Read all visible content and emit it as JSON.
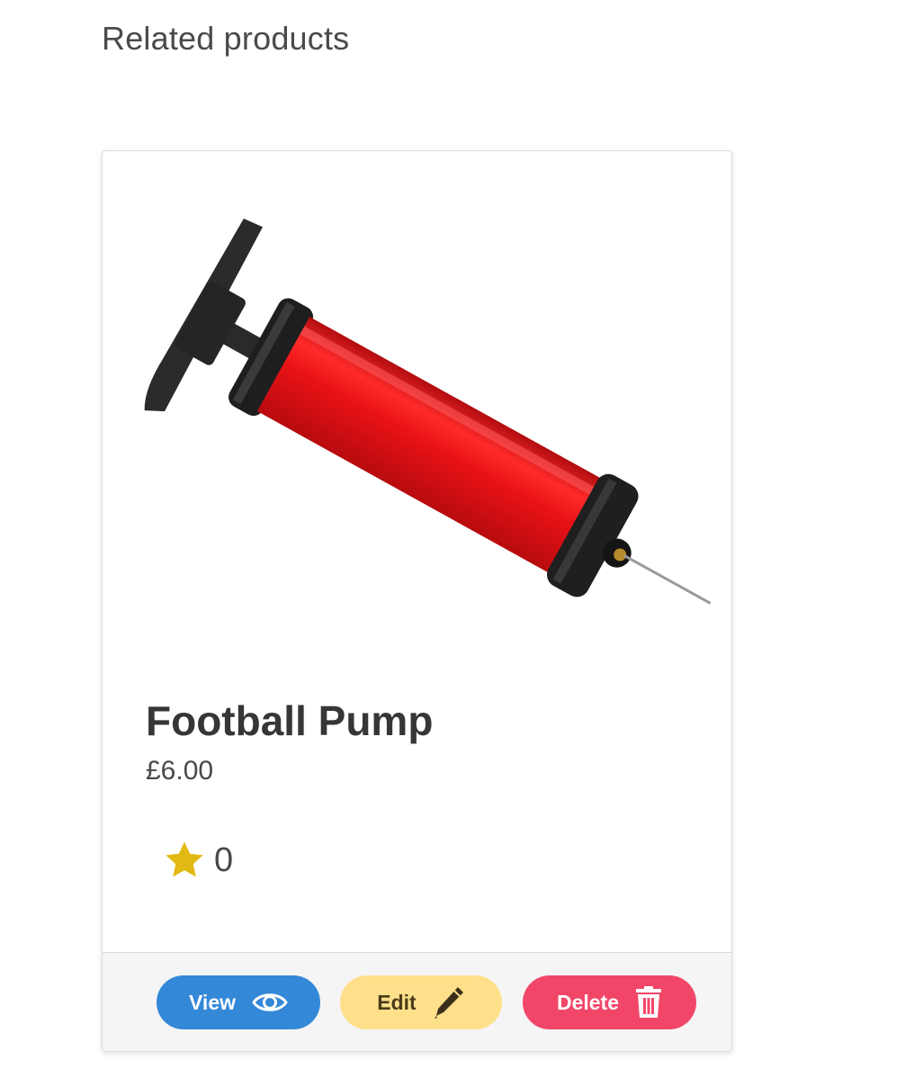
{
  "section": {
    "title": "Related products"
  },
  "product": {
    "name": "Football Pump",
    "price": "£6.00",
    "rating": "0"
  },
  "actions": {
    "view_label": "View",
    "edit_label": "Edit",
    "delete_label": "Delete"
  },
  "icons": {
    "rating": "star-icon",
    "view": "eye-icon",
    "edit": "pen-icon",
    "delete": "trash-icon"
  },
  "colors": {
    "view_button": "#3488d8",
    "edit_button": "#ffe08a",
    "delete_button": "#f14668",
    "star": "#e2b914",
    "pump_body": "#e81216"
  }
}
